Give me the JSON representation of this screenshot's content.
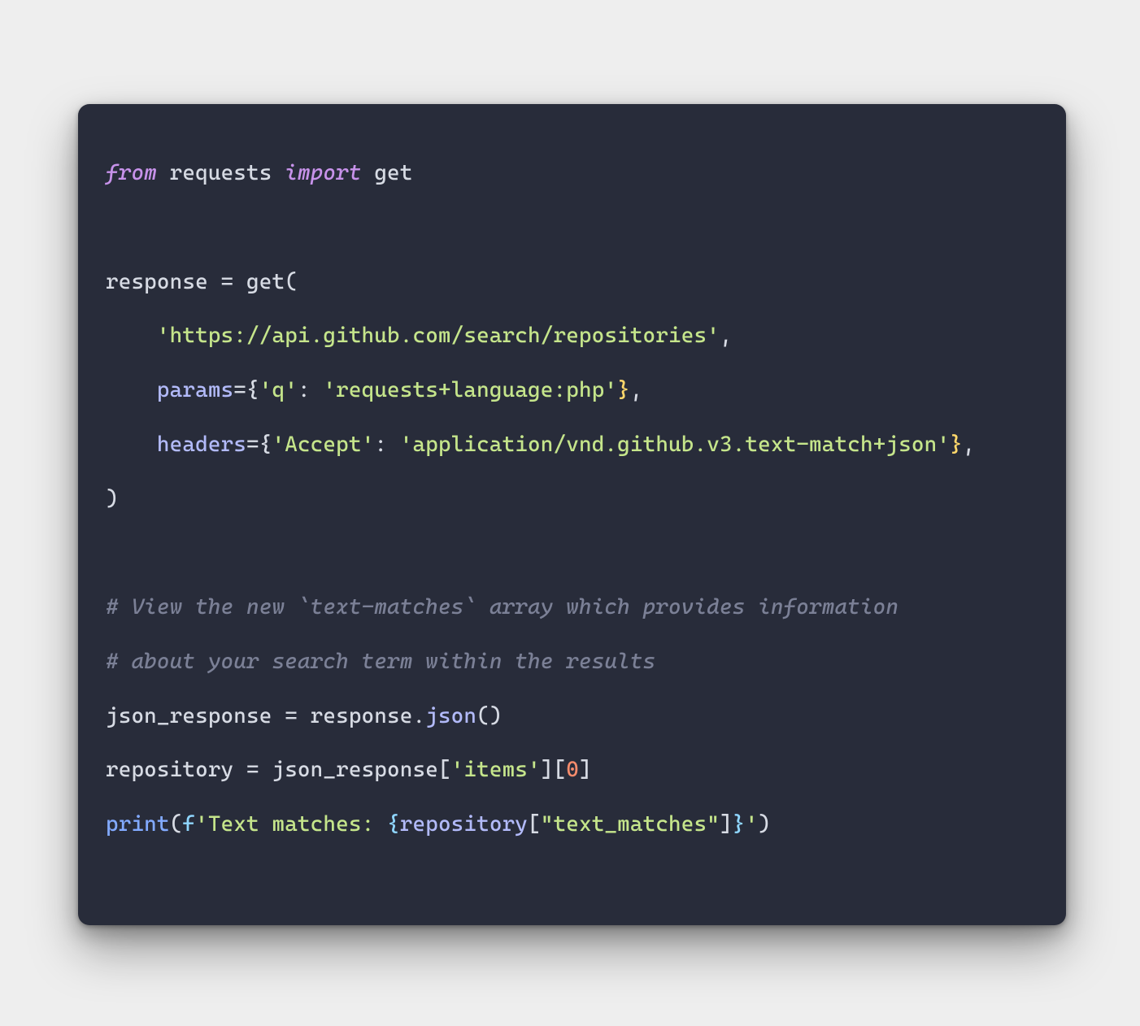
{
  "code": {
    "line1": {
      "from": "from",
      "mod": "requests",
      "import": "import",
      "name": "get"
    },
    "line3": {
      "lhs": "response ",
      "eq": "=",
      "call": " get("
    },
    "line4": {
      "indent": "    ",
      "str": "'https://api.github.com/search/repositories'",
      "comma": ","
    },
    "line5": {
      "indent": "    ",
      "param": "params",
      "eq": "=",
      "open": "{",
      "key": "'q'",
      "colon": ": ",
      "val": "'requests+language:php'",
      "close": "}",
      "comma": ","
    },
    "line6": {
      "indent": "    ",
      "param": "headers",
      "eq": "=",
      "open": "{",
      "key": "'Accept'",
      "colon": ": ",
      "val": "'application/vnd.github.v3.text-match+json'",
      "close": "}",
      "comma": ","
    },
    "line7": {
      "close": ")"
    },
    "line9": {
      "text": "# View the new `text-matches` array which provides information"
    },
    "line10": {
      "text": "# about your search term within the results"
    },
    "line11": {
      "lhs": "json_response ",
      "eq": "=",
      "rhs_a": " response.",
      "method": "json",
      "tail": "()"
    },
    "line12": {
      "lhs": "repository ",
      "eq": "=",
      "rhs_a": " json_response[",
      "key": "'items'",
      "mid": "][",
      "num": "0",
      "tail": "]"
    },
    "line13": {
      "fn": "print",
      "open": "(",
      "f": "f",
      "s1": "'Text matches: ",
      "bopen": "{",
      "var": "repository",
      "sub_open": "[",
      "key": "\"text_matches\"",
      "sub_close": "]",
      "bclose": "}",
      "s2": "'",
      "close": ")"
    }
  }
}
